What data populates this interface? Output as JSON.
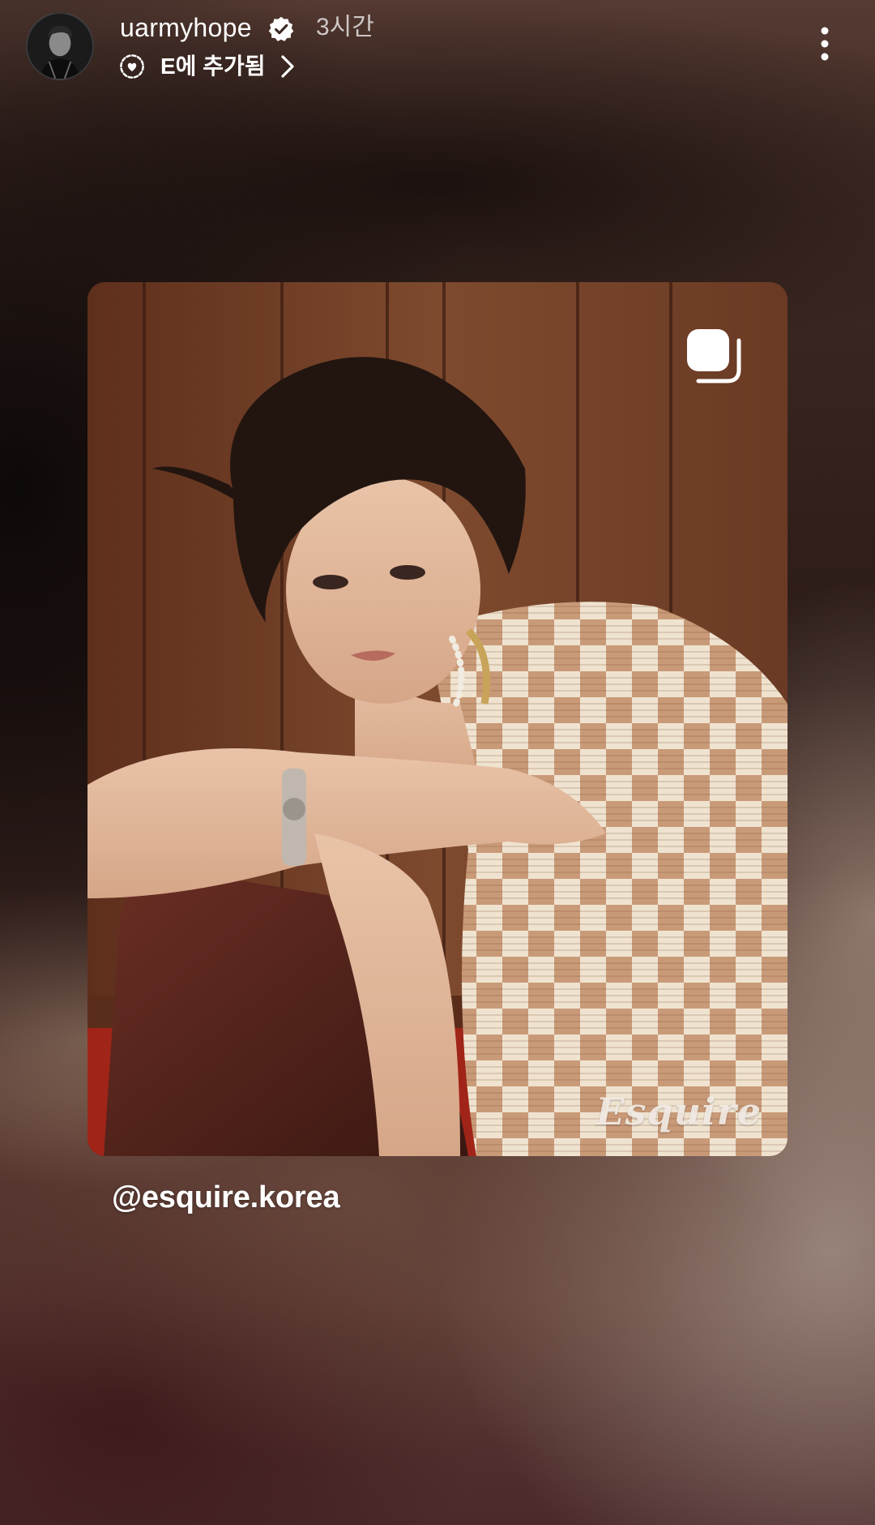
{
  "header": {
    "username": "uarmyhope",
    "verified": true,
    "timestamp": "3시간",
    "highlight_label": "E에 추가됨",
    "icons": {
      "verified": "verified-badge-icon",
      "highlight": "highlight-heart-icon",
      "chevron": "chevron-right-icon",
      "more": "more-vertical-icon",
      "avatar": "avatar"
    }
  },
  "post": {
    "brand_watermark": "Esquire",
    "carousel_icon": "carousel-icon"
  },
  "mention": {
    "text": "@esquire.korea"
  },
  "colors": {
    "text_primary": "#ffffff",
    "text_secondary": "#b7aaa5",
    "verified_badge": "#ffffff",
    "background_dark": "#2a1a16",
    "panel_wood": "#7a4428"
  }
}
